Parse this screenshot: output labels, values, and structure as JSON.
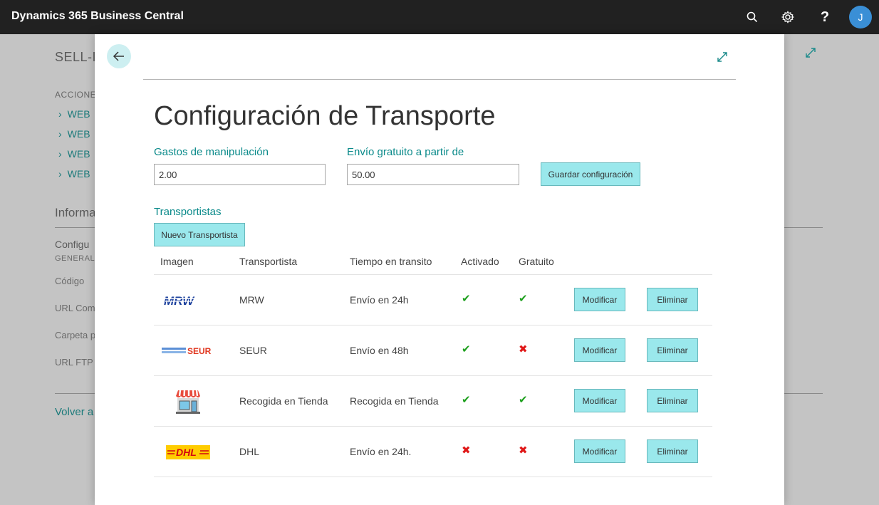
{
  "app": {
    "title": "Dynamics 365 Business Central",
    "avatar_initial": "J",
    "help_label": "?"
  },
  "background": {
    "title": "SELL-I",
    "actions_heading": "ACCIONE",
    "links": [
      "WEB",
      "WEB",
      "WEB",
      "WEB"
    ],
    "info_heading": "Informa",
    "config_label": "Configu",
    "general_label": "GENERAL",
    "fields": [
      "Código",
      "URL Com",
      "Carpeta p",
      "URL FTP"
    ],
    "back_link": "Volver a"
  },
  "modal": {
    "title": "Configuración de Transporte",
    "handling": {
      "label": "Gastos de manipulación",
      "value": "2.00"
    },
    "free_shipping": {
      "label": "Envío gratuito a partir de",
      "value": "50.00"
    },
    "save_label": "Guardar configuración",
    "carriers_label": "Transportistas",
    "new_carrier_label": "Nuevo Transportista",
    "columns": {
      "image": "Imagen",
      "carrier": "Transportista",
      "transit": "Tiempo en transito",
      "active": "Activado",
      "free": "Gratuito"
    },
    "rows": [
      {
        "name": "MRW",
        "transit": "Envío en 24h",
        "active": "yes",
        "free": "yes",
        "logo_text": "MRW"
      },
      {
        "name": "SEUR",
        "transit": "Envío en 48h",
        "active": "yes",
        "free": "no",
        "logo_text": "SEUR"
      },
      {
        "name": "Recogida en Tienda",
        "transit": "Recogida en Tienda",
        "active": "yes",
        "free": "yes",
        "logo_text": ""
      },
      {
        "name": "DHL",
        "transit": "Envío en 24h.",
        "active": "no",
        "free": "no",
        "logo_text": "DHL"
      }
    ],
    "modify_label": "Modificar",
    "delete_label": "Eliminar"
  },
  "icons": {
    "check": "✔",
    "cross": "✖",
    "chevron": "›"
  },
  "colors": {
    "accent": "#0a8a8a",
    "button_bg": "#9ae8ec",
    "topbar": "#212121",
    "check": "#1ea01e",
    "cross": "#e01818"
  }
}
